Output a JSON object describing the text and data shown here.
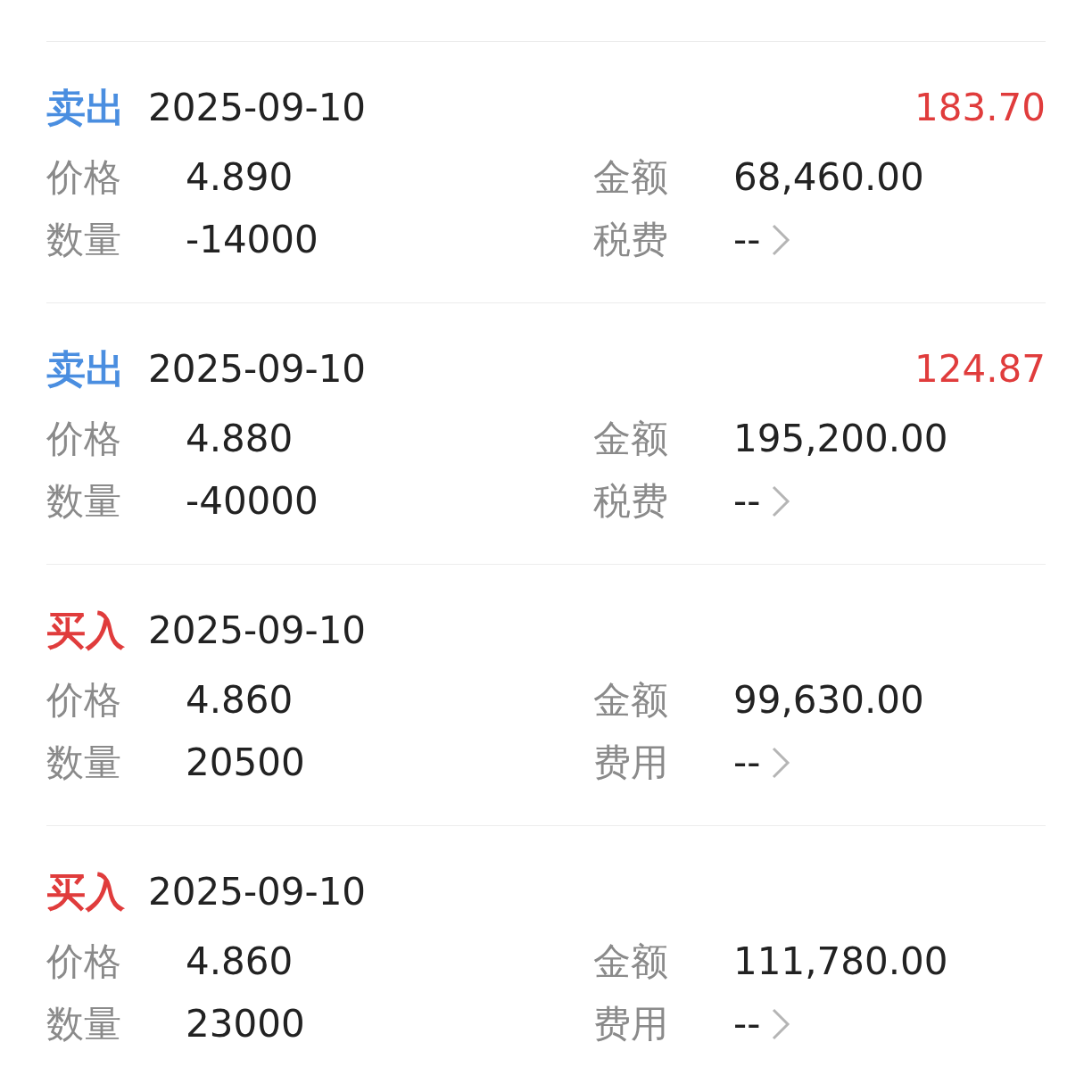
{
  "records": [
    {
      "kind": "sell",
      "type_label": "卖出",
      "date": "2025-09-10",
      "profit": "183.70",
      "price_label": "价格",
      "price": "4.890",
      "amount_label": "金额",
      "amount": "68,460.00",
      "quantity_label": "数量",
      "quantity": "-14000",
      "fee_label": "税费",
      "fee": "--"
    },
    {
      "kind": "sell",
      "type_label": "卖出",
      "date": "2025-09-10",
      "profit": "124.87",
      "price_label": "价格",
      "price": "4.880",
      "amount_label": "金额",
      "amount": "195,200.00",
      "quantity_label": "数量",
      "quantity": "-40000",
      "fee_label": "税费",
      "fee": "--"
    },
    {
      "kind": "buy",
      "type_label": "买入",
      "date": "2025-09-10",
      "price_label": "价格",
      "price": "4.860",
      "amount_label": "金额",
      "amount": "99,630.00",
      "quantity_label": "数量",
      "quantity": "20500",
      "fee_label": "费用",
      "fee": "--"
    },
    {
      "kind": "buy",
      "type_label": "买入",
      "date": "2025-09-10",
      "price_label": "价格",
      "price": "4.860",
      "amount_label": "金额",
      "amount": "111,780.00",
      "quantity_label": "数量",
      "quantity": "23000",
      "fee_label": "费用",
      "fee": "--"
    }
  ]
}
